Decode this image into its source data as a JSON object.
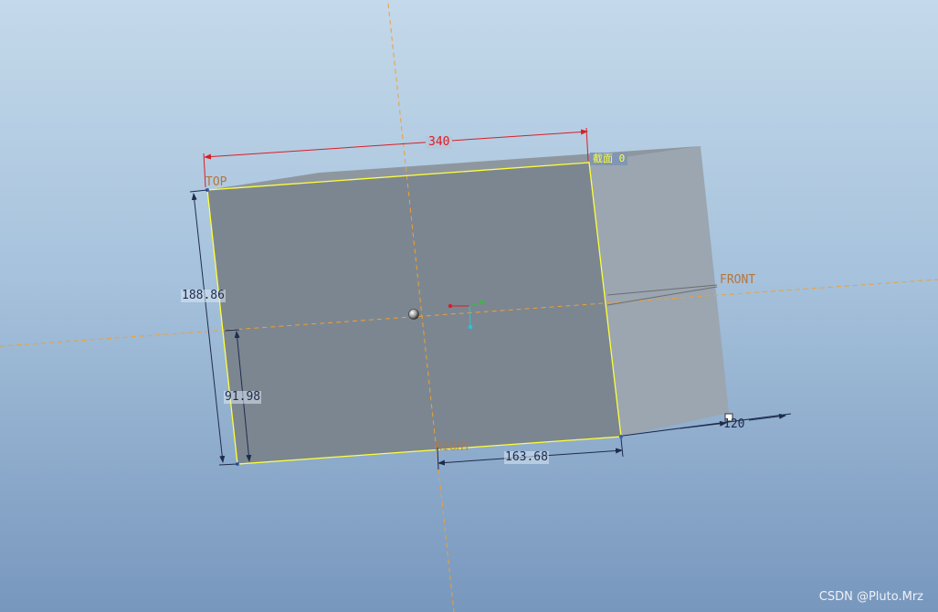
{
  "dimensions": {
    "width_top": "340",
    "height_left": "188.86",
    "height_inner": "91.98",
    "width_bottom": "163.68",
    "depth": "120"
  },
  "datum_planes": {
    "top": "TOP",
    "front": "FRONT",
    "right": "RIGHT"
  },
  "section_label": "截面 0",
  "watermark": "CSDN @Pluto.Mrz",
  "colors": {
    "background_top": "#c4d9ea",
    "background_bottom": "#7897bd",
    "front_face": "#7c8690",
    "side_face": "#9ba6b1",
    "top_face": "#8e979f",
    "outline": "#ffff3a",
    "datum_line": "#f0a030",
    "dimension_red": "#d81f26",
    "dimension_dark": "#1e2c4e"
  }
}
